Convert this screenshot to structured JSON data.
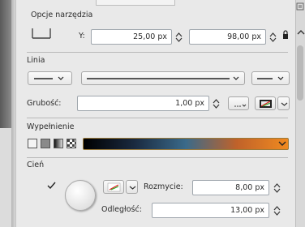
{
  "tool_options": {
    "title": "Opcje narzędzia",
    "position": {
      "y_label": "Y:",
      "y_value": "25,00 px",
      "second_value": "98,00 px"
    }
  },
  "line": {
    "title": "Linia",
    "thickness_label": "Grubość:",
    "thickness_value": "1,00 px"
  },
  "fill": {
    "title": "Wypełnienie",
    "gradient_colors": [
      "#000000",
      "#1a2a40",
      "#3a6a8a",
      "#c0622a",
      "#f08a20"
    ]
  },
  "shadow": {
    "title": "Cień",
    "blur_label": "Rozmycie:",
    "blur_value": "8,00 px",
    "distance_label": "Odległość:",
    "distance_value": "13,00 px"
  }
}
